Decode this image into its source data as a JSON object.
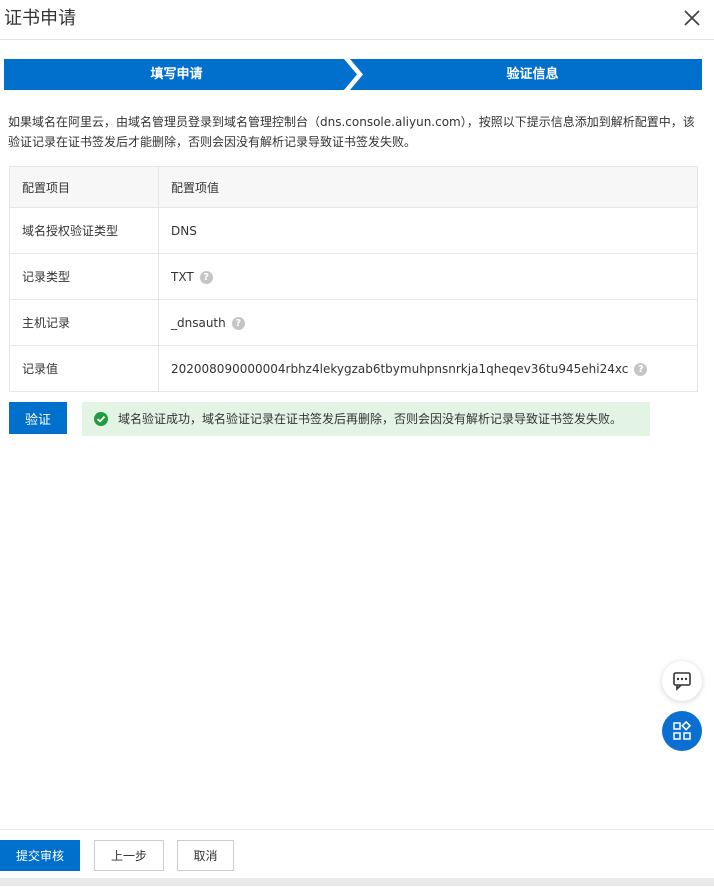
{
  "dialog": {
    "title": "证书申请"
  },
  "steps": [
    {
      "label": "填写申请"
    },
    {
      "label": "验证信息"
    }
  ],
  "intro_text": "如果域名在阿里云，由域名管理员登录到域名管理控制台（dns.console.aliyun.com），按照以下提示信息添加到解析配置中，该验证记录在证书签发后才能删除，否则会因没有解析记录导致证书签发失败。",
  "table": {
    "headers": [
      "配置项目",
      "配置项值"
    ],
    "rows": [
      {
        "key": "域名授权验证类型",
        "value": "DNS",
        "help": false
      },
      {
        "key": "记录类型",
        "value": "TXT",
        "help": true
      },
      {
        "key": "主机记录",
        "value": "_dnsauth",
        "help": true
      },
      {
        "key": "记录值",
        "value": "202008090000004rbhz4lekygzab6tbymuhpnsnrkja1qheqev36tu945ehi24xc",
        "help": true
      }
    ]
  },
  "verify_button": "验证",
  "success_message": "域名验证成功，域名验证记录在证书签发后再删除，否则会因没有解析记录导致证书签发失败。",
  "footer": {
    "submit": "提交审核",
    "prev": "上一步",
    "cancel": "取消"
  },
  "colors": {
    "primary": "#0070cc",
    "success_bg": "#e3f4e5",
    "success_icon": "#1e9c3f"
  },
  "icons": {
    "close": "close-icon",
    "help": "question-icon",
    "success": "check-circle-icon",
    "chat": "chat-icon",
    "apps": "apps-icon"
  }
}
